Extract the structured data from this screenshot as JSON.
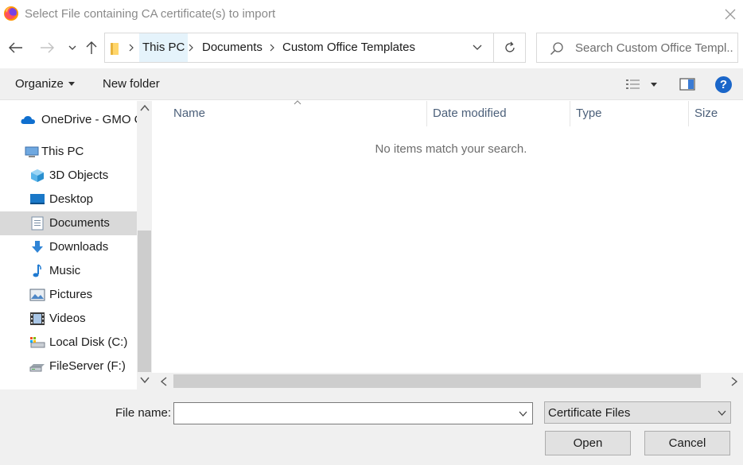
{
  "window": {
    "title": "Select File containing CA certificate(s) to import"
  },
  "address": {
    "crumbs": [
      "This PC",
      "Documents",
      "Custom Office Templates"
    ]
  },
  "search": {
    "placeholder": "Search Custom Office Templ..."
  },
  "toolbar": {
    "organize_label": "Organize",
    "new_folder_label": "New folder",
    "help_label": "?"
  },
  "sidebar": {
    "items": [
      {
        "label": "OneDrive - GMO C",
        "icon": "cloud-icon"
      },
      {
        "label": "This PC",
        "icon": "computer-icon"
      },
      {
        "label": "3D Objects",
        "icon": "cube-icon"
      },
      {
        "label": "Desktop",
        "icon": "desktop-icon"
      },
      {
        "label": "Documents",
        "icon": "document-icon",
        "selected": true
      },
      {
        "label": "Downloads",
        "icon": "download-arrow-icon"
      },
      {
        "label": "Music",
        "icon": "music-note-icon"
      },
      {
        "label": "Pictures",
        "icon": "picture-icon"
      },
      {
        "label": "Videos",
        "icon": "film-icon"
      },
      {
        "label": "Local Disk (C:)",
        "icon": "local-disk-icon"
      },
      {
        "label": "FileServer (F:)",
        "icon": "network-drive-icon"
      }
    ]
  },
  "filelist": {
    "columns": [
      "Name",
      "Date modified",
      "Type",
      "Size"
    ],
    "empty_message": "No items match your search."
  },
  "bottom": {
    "file_name_label": "File name:",
    "file_name_value": "",
    "file_type_value": "Certificate Files",
    "open_label": "Open",
    "cancel_label": "Cancel"
  },
  "colors": {
    "accent": "#1a66c9",
    "selected_bg": "#d9d9d9",
    "toolbar_bg": "#f0f0f0"
  }
}
